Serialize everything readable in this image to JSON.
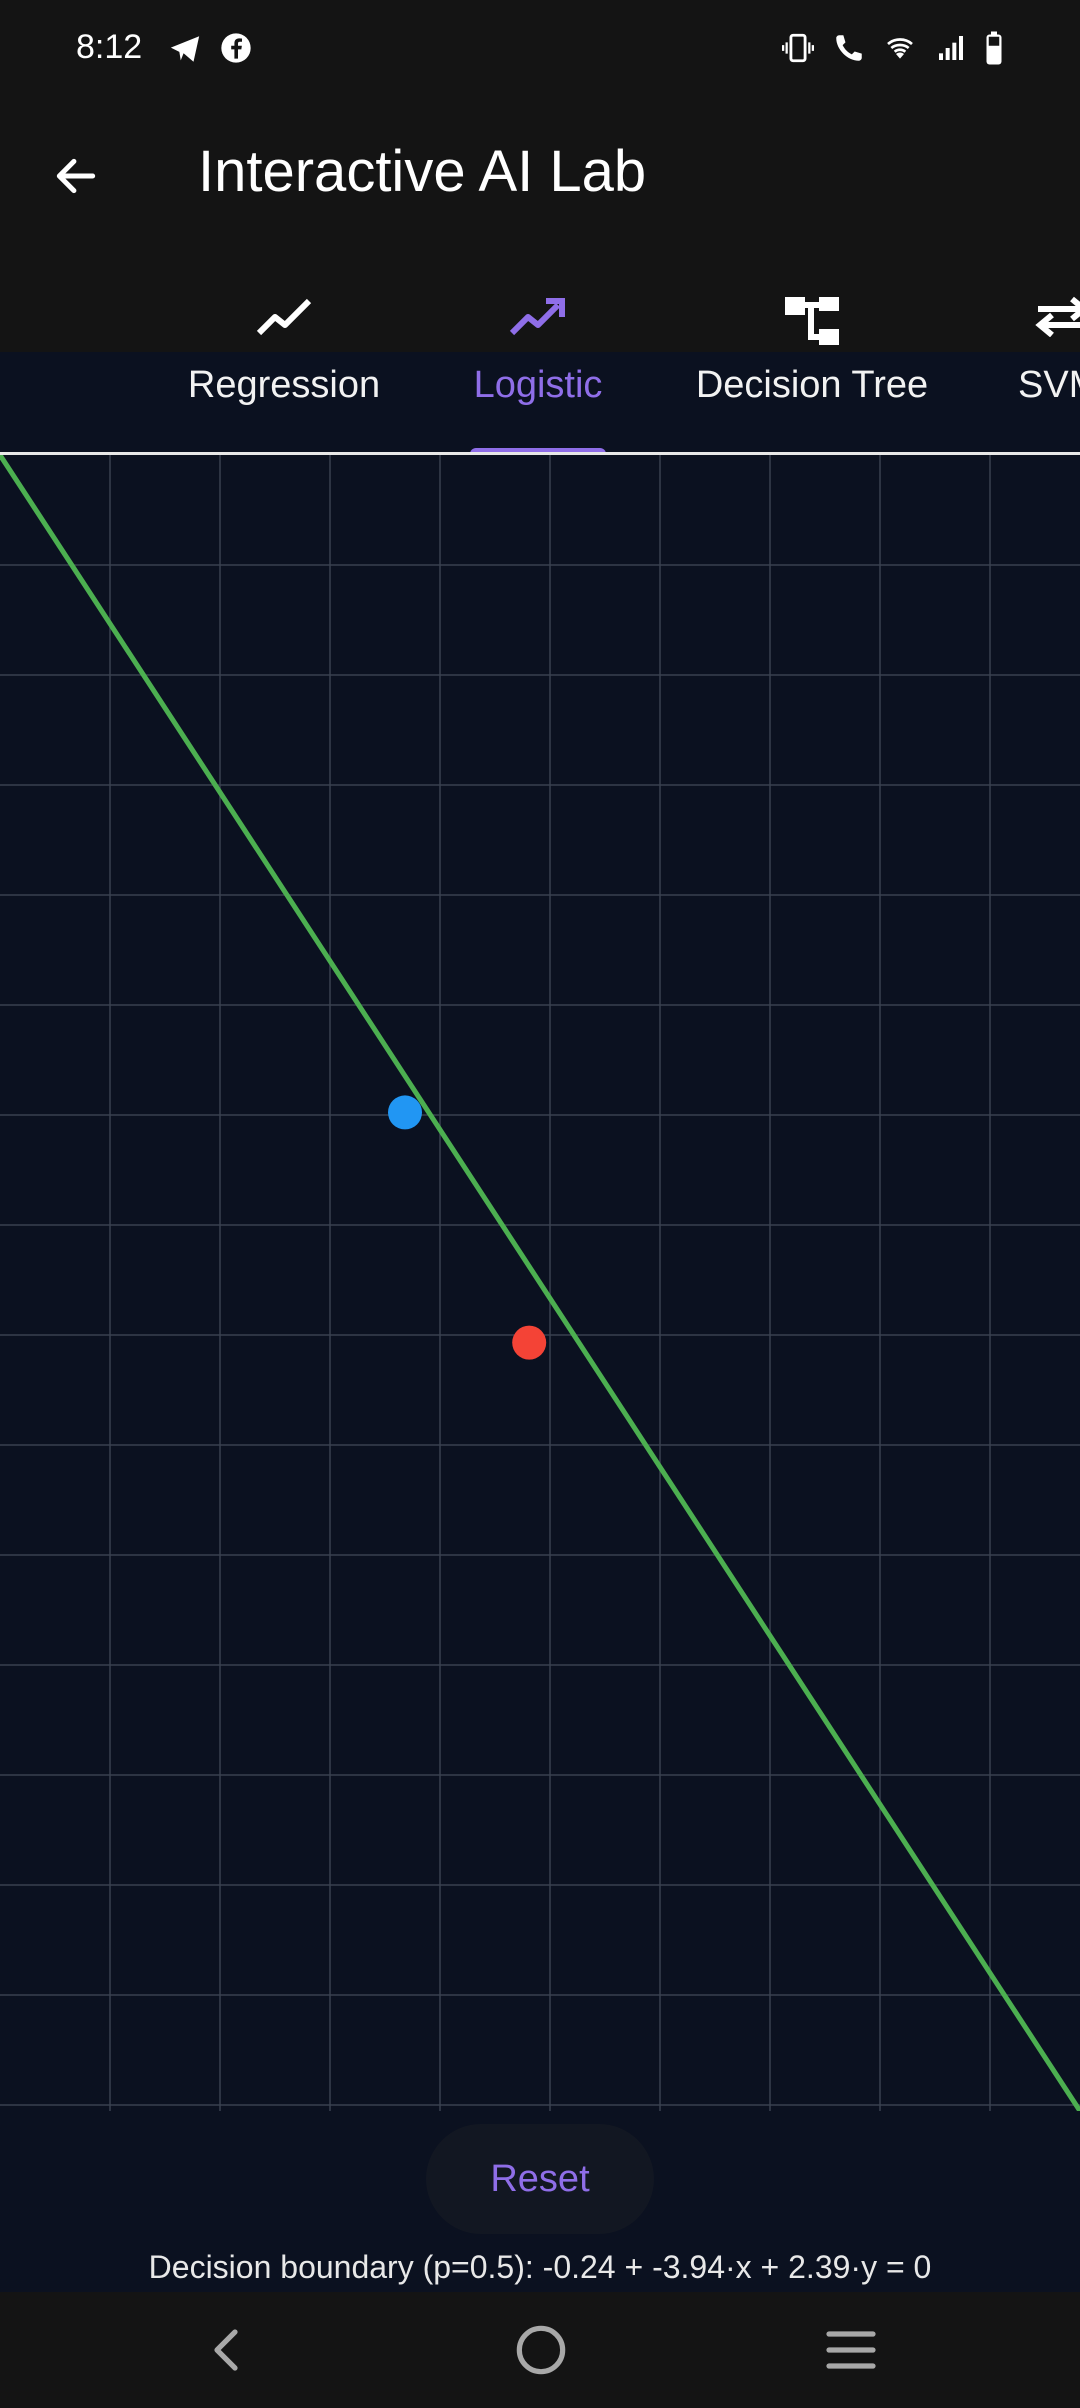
{
  "status_bar": {
    "time": "8:12"
  },
  "header": {
    "title": "Interactive AI Lab"
  },
  "tabs": [
    {
      "label": "Regression",
      "icon": "line-chart-icon",
      "active": false
    },
    {
      "label": "Logistic",
      "icon": "trending-up-icon",
      "active": true
    },
    {
      "label": "Decision Tree",
      "icon": "tree-structure-icon",
      "active": false
    },
    {
      "label": "SVM",
      "icon": "swap-arrows-icon",
      "active": false
    }
  ],
  "plot": {
    "points": [
      {
        "class": "blue",
        "color": "#2196f3",
        "x": 0.375,
        "y": 0.397
      },
      {
        "class": "red",
        "color": "#f44336",
        "x": 0.49,
        "y": 0.536
      }
    ],
    "boundary_color": "#4caf50",
    "grid": true
  },
  "controls": {
    "reset_label": "Reset"
  },
  "footer": {
    "boundary_text": "Decision boundary (p=0.5): -0.24 + -3.94·x + 2.39·y = 0"
  },
  "colors": {
    "accent": "#8f6ee8",
    "background": "#0b1120",
    "bar": "#141414"
  }
}
